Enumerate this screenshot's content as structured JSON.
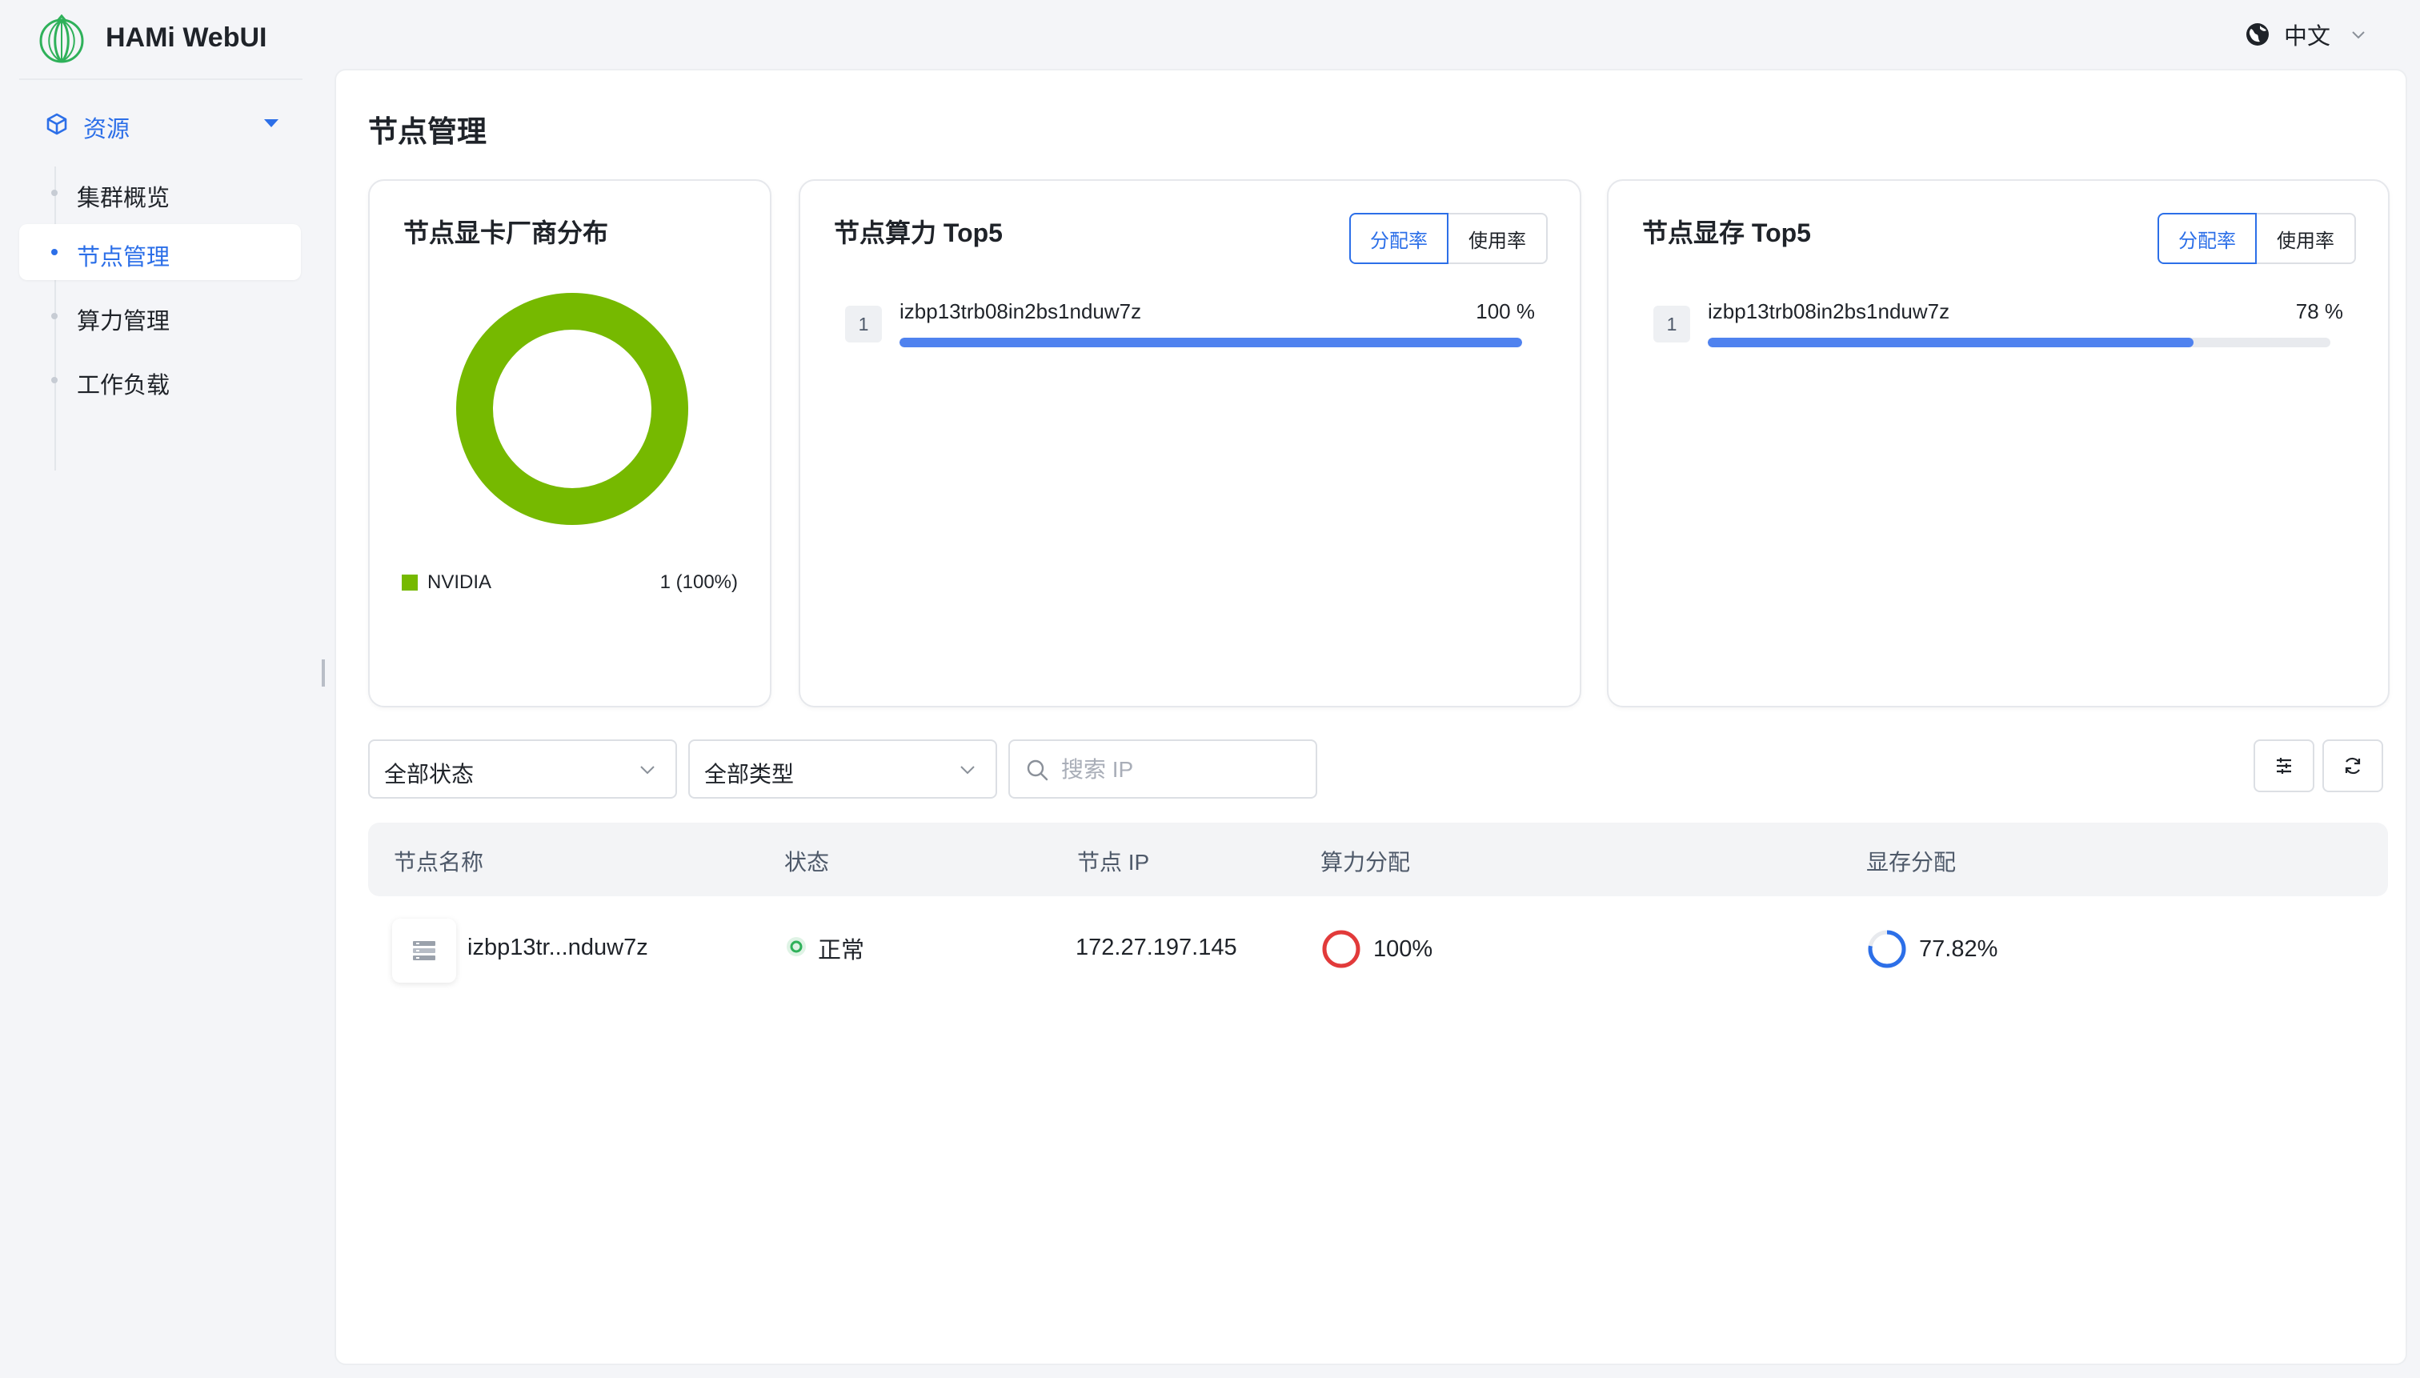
{
  "app": {
    "title": "HAMi WebUI",
    "language": "中文"
  },
  "sidebar": {
    "group_label": "资源",
    "items": [
      {
        "label": "集群概览",
        "active": false
      },
      {
        "label": "节点管理",
        "active": true
      },
      {
        "label": "算力管理",
        "active": false
      },
      {
        "label": "工作负载",
        "active": false
      }
    ]
  },
  "page": {
    "title": "节点管理"
  },
  "vendor_card": {
    "title": "节点显卡厂商分布",
    "legend": [
      {
        "name": "NVIDIA",
        "value": "1 (100%)",
        "color": "#76b900",
        "fraction": 1.0
      }
    ]
  },
  "compute_card": {
    "title": "节点算力 Top5",
    "toggle": [
      "分配率",
      "使用率"
    ],
    "active_toggle": "分配率",
    "rows": [
      {
        "rank": "1",
        "name": "izbp13trb08in2bs1nduw7z",
        "value": "100 %",
        "fraction": 1.0
      }
    ]
  },
  "memory_card": {
    "title": "节点显存 Top5",
    "toggle": [
      "分配率",
      "使用率"
    ],
    "active_toggle": "分配率",
    "rows": [
      {
        "rank": "1",
        "name": "izbp13trb08in2bs1nduw7z",
        "value": "78 %",
        "fraction": 0.78
      }
    ]
  },
  "filters": {
    "status_select": "全部状态",
    "type_select": "全部类型",
    "search_placeholder": "搜索 IP"
  },
  "table": {
    "columns": [
      "节点名称",
      "状态",
      "节点 IP",
      "算力分配",
      "显存分配"
    ],
    "rows": [
      {
        "name": "izbp13tr...nduw7z",
        "status": "正常",
        "ip": "172.27.197.145",
        "compute": "100%",
        "compute_fraction": 1.0,
        "memory": "77.82%",
        "memory_fraction": 0.7782
      }
    ]
  },
  "colors": {
    "accent": "#2c6fe8",
    "nvidia_green": "#76b900",
    "bar_blue": "#4f82ef",
    "danger_red": "#e23a3a",
    "status_green": "#2fb15a"
  }
}
